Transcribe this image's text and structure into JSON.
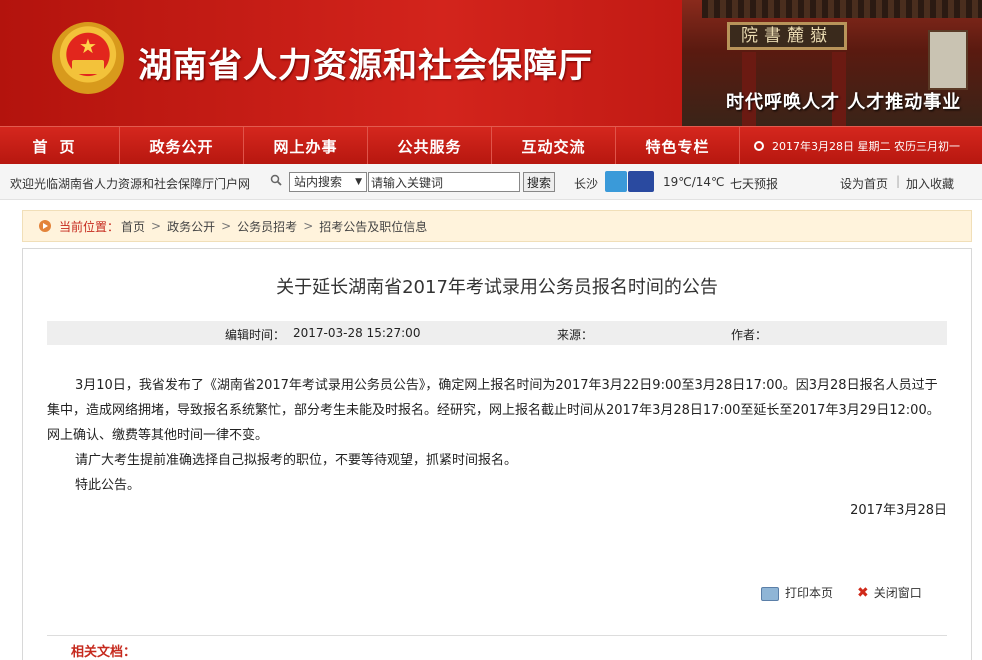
{
  "header": {
    "site_title": "湖南省人力资源和社会保障厅",
    "slogan": "时代呼唤人才  人才推动事业",
    "plaque": "院書麓嶽"
  },
  "nav": {
    "items": [
      "首页",
      "政务公开",
      "网上办事",
      "公共服务",
      "互动交流",
      "特色专栏"
    ],
    "date": "2017年3月28日 星期二 农历三月初一"
  },
  "toolbar": {
    "welcome": "欢迎光临湖南省人力资源和社会保障厅门户网",
    "search_scope": "站内搜索",
    "search_placeholder": "请输入关键词",
    "search_button": "搜索",
    "city": "长沙",
    "temperature": "19℃/14℃",
    "forecast": "七天预报",
    "set_home": "设为首页",
    "separator": "|",
    "add_favorite": "加入收藏"
  },
  "breadcrumb": {
    "label": "当前位置：",
    "items": [
      "首页",
      "政务公开",
      "公务员招考",
      "招考公告及职位信息"
    ]
  },
  "article": {
    "title": "关于延长湖南省2017年考试录用公务员报名时间的公告",
    "meta": {
      "edit_time_label": "编辑时间：",
      "edit_time": "2017-03-28 15:27:00",
      "source_label": "来源：",
      "author_label": "作者："
    },
    "paragraphs": [
      "3月10日，我省发布了《湖南省2017年考试录用公务员公告》，确定网上报名时间为2017年3月22日9:00至3月28日17:00。因3月28日报名人员过于集中，造成网络拥堵，导致报名系统繁忙，部分考生未能及时报名。经研究，网上报名截止时间从2017年3月28日17:00至延长至2017年3月29日12:00。网上确认、缴费等其他时间一律不变。",
      "请广大考生提前准确选择自己拟报考的职位，不要等待观望，抓紧时间报名。",
      "特此公告。"
    ],
    "date": "2017年3月28日",
    "print_label": "打印本页",
    "close_label": "关闭窗口",
    "related_label": "相关文档："
  },
  "colors": {
    "brand_red": "#c11a14",
    "breadcrumb_bg": "#fff3dc",
    "accent_text": "#c62a1e"
  }
}
